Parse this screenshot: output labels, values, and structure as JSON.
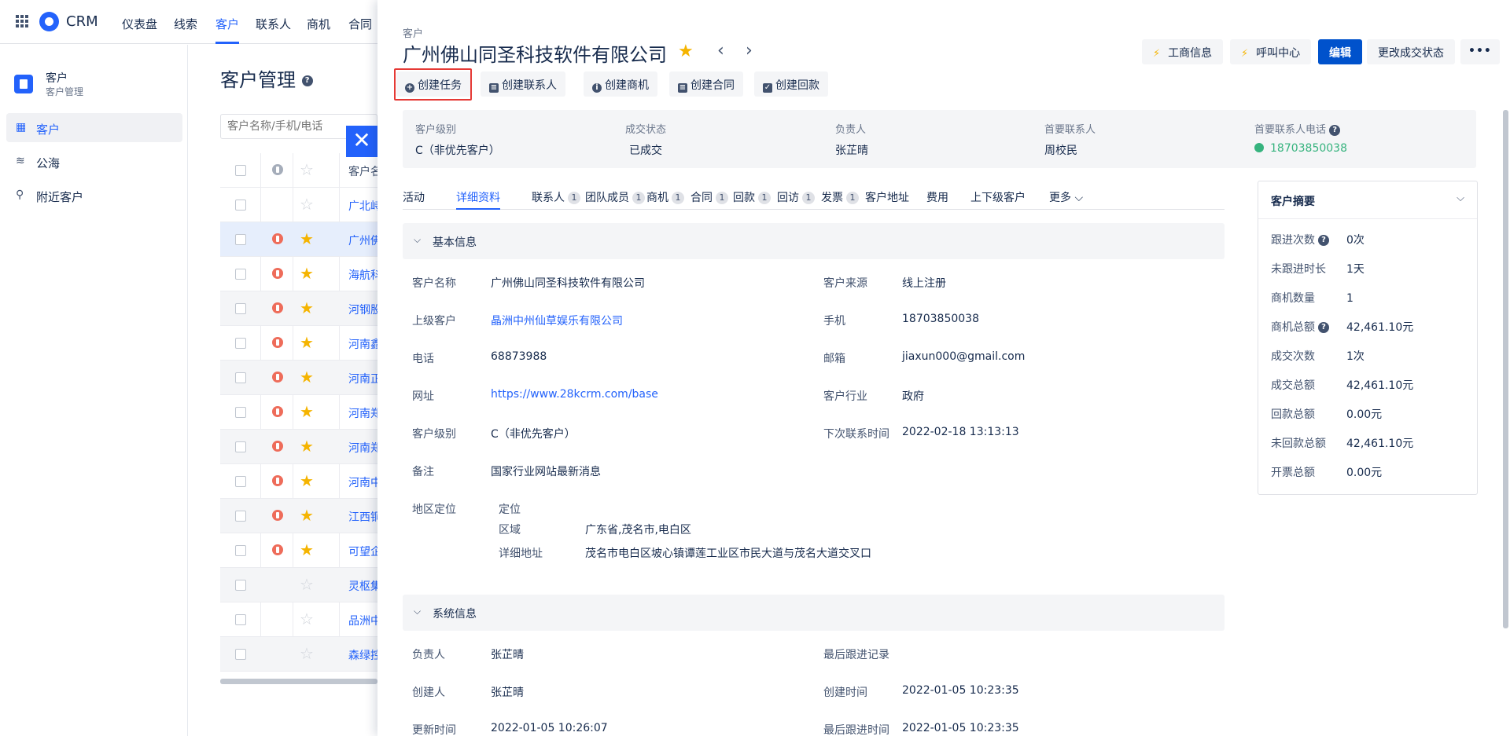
{
  "topnav": {
    "brand": "CRM",
    "items": [
      "仪表盘",
      "线索",
      "客户",
      "联系人",
      "商机",
      "合同"
    ]
  },
  "sidebar": {
    "module_title": "客户",
    "module_sub": "客户管理",
    "items": [
      {
        "label": "客户",
        "icon": "building-icon"
      },
      {
        "label": "公海",
        "icon": "waves-icon"
      },
      {
        "label": "附近客户",
        "icon": "location-pin-icon"
      }
    ]
  },
  "list": {
    "title": "客户管理",
    "search_placeholder": "客户名称/手机/电话",
    "header_name": "客户名",
    "rows": [
      {
        "name": "广北峙",
        "locked": false,
        "starred": false
      },
      {
        "name": "广州佛",
        "locked": true,
        "starred": true
      },
      {
        "name": "海航科",
        "locked": true,
        "starred": true
      },
      {
        "name": "河钢股",
        "locked": true,
        "starred": true
      },
      {
        "name": "河南鑫",
        "locked": true,
        "starred": true
      },
      {
        "name": "河南正",
        "locked": true,
        "starred": true
      },
      {
        "name": "河南郑",
        "locked": true,
        "starred": true
      },
      {
        "name": "河南郑",
        "locked": true,
        "starred": true
      },
      {
        "name": "河南中",
        "locked": true,
        "starred": true
      },
      {
        "name": "江西铜",
        "locked": true,
        "starred": true
      },
      {
        "name": "可望企",
        "locked": true,
        "starred": true
      },
      {
        "name": "灵枢集",
        "locked": false,
        "starred": false
      },
      {
        "name": "品洲中",
        "locked": false,
        "starred": false
      },
      {
        "name": "森绿控",
        "locked": false,
        "starred": false
      }
    ]
  },
  "drawer": {
    "crumb": "客户",
    "title": "广州佛山同圣科技软件有限公司",
    "top_buttons": {
      "biz_info": "工商信息",
      "call_center": "呼叫中心",
      "edit": "编辑",
      "change_status": "更改成交状态",
      "more": "•••"
    },
    "actions": {
      "create_task": "创建任务",
      "create_contact": "创建联系人",
      "create_opportunity": "创建商机",
      "create_contract": "创建合同",
      "create_payment": "创建回款"
    },
    "summary": {
      "level_label": "客户级别",
      "level": "C（非优先客户）",
      "status_label": "成交状态",
      "status": "已成交",
      "owner_label": "负责人",
      "owner": "张芷晴",
      "primary_contact_label": "首要联系人",
      "primary_contact": "周校民",
      "primary_phone_label": "首要联系人电话",
      "primary_phone": "18703850038"
    },
    "tabs": [
      {
        "label": "活动",
        "count": ""
      },
      {
        "label": "详细资料",
        "count": ""
      },
      {
        "label": "联系人",
        "count": "1"
      },
      {
        "label": "团队成员",
        "count": "1"
      },
      {
        "label": "商机",
        "count": "1"
      },
      {
        "label": "合同",
        "count": "1"
      },
      {
        "label": "回款",
        "count": "1"
      },
      {
        "label": "回访",
        "count": "1"
      },
      {
        "label": "发票",
        "count": "1"
      },
      {
        "label": "客户地址",
        "count": ""
      },
      {
        "label": "费用",
        "count": ""
      },
      {
        "label": "上下级客户",
        "count": ""
      },
      {
        "label": "更多",
        "count": ""
      }
    ],
    "basic": {
      "section_title": "基本信息",
      "name_label": "客户名称",
      "name": "广州佛山同圣科技软件有限公司",
      "source_label": "客户来源",
      "source": "线上注册",
      "parent_label": "上级客户",
      "parent": "晶洲中州仙草娱乐有限公司",
      "mobile_label": "手机",
      "mobile": "18703850038",
      "phone_label": "电话",
      "phone": "68873988",
      "email_label": "邮箱",
      "email": "jiaxun000@gmail.com",
      "website_label": "网址",
      "website": "https://www.28kcrm.com/base",
      "industry_label": "客户行业",
      "industry": "政府",
      "level_label": "客户级别",
      "level": "C（非优先客户）",
      "next_contact_label": "下次联系时间",
      "next_contact": "2022-02-18 13:13:13",
      "remark_label": "备注",
      "remark": "国家行业网站最新消息",
      "region_label": "地区定位",
      "locate_label": "定位",
      "area_label": "区域",
      "area": "广东省,茂名市,电白区",
      "address_label": "详细地址",
      "address": "茂名市电白区坡心镇谭莲工业区市民大道与茂名大道交叉口"
    },
    "system": {
      "section_title": "系统信息",
      "owner_label": "负责人",
      "owner": "张芷晴",
      "last_follow_label": "最后跟进记录",
      "last_follow": "",
      "creator_label": "创建人",
      "creator": "张芷晴",
      "created_label": "创建时间",
      "created": "2022-01-05 10:23:35",
      "updated_label": "更新时间",
      "updated": "2022-01-05 10:26:07",
      "last_follow_time_label": "最后跟进时间",
      "last_follow_time": "2022-01-05 10:23:35"
    },
    "customer_summary": {
      "title": "客户摘要",
      "rows": [
        {
          "label": "跟进次数",
          "value": "0次",
          "help": true
        },
        {
          "label": "未跟进时长",
          "value": "1天",
          "help": false
        },
        {
          "label": "商机数量",
          "value": "1",
          "help": false
        },
        {
          "label": "商机总额",
          "value": "42,461.10元",
          "help": true
        },
        {
          "label": "成交次数",
          "value": "1次",
          "help": false
        },
        {
          "label": "成交总额",
          "value": "42,461.10元",
          "help": false
        },
        {
          "label": "回款总额",
          "value": "0.00元",
          "help": false
        },
        {
          "label": "未回款总额",
          "value": "42,461.10元",
          "help": false
        },
        {
          "label": "开票总额",
          "value": "0.00元",
          "help": false
        }
      ]
    }
  },
  "colors": {
    "accent": "#2362fb",
    "primary_button": "#0052cc",
    "star": "#f5b400",
    "phone_green": "#36b37e",
    "highlight_red": "#e53935"
  }
}
